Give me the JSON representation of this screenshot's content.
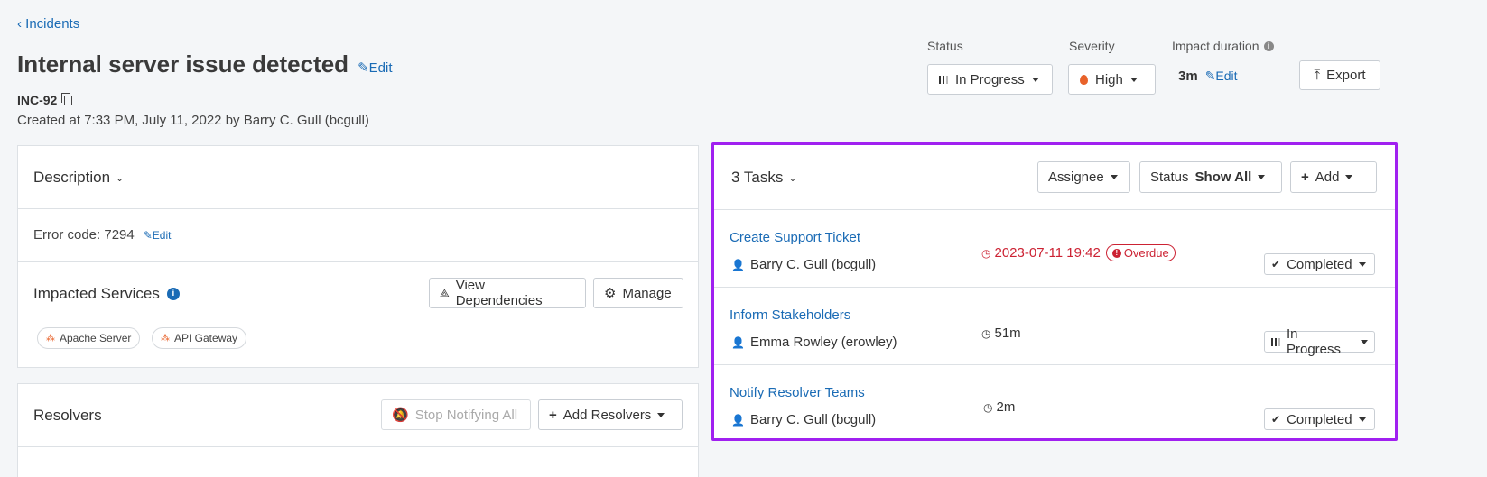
{
  "breadcrumb": {
    "back_label": "Incidents"
  },
  "incident": {
    "title": "Internal server issue detected",
    "edit_label": "Edit",
    "id": "INC-92",
    "created": "Created at 7:33 PM, July 11, 2022 by Barry C. Gull (bcgull)"
  },
  "header": {
    "status_label": "Status",
    "status_value": "In Progress",
    "severity_label": "Severity",
    "severity_value": "High",
    "impact_label": "Impact duration",
    "impact_value": "3m",
    "impact_edit_label": "Edit",
    "export_label": "Export"
  },
  "description": {
    "heading": "Description",
    "text": "Error code: 7294",
    "edit_label": "Edit"
  },
  "impacted_services": {
    "heading": "Impacted Services",
    "view_dependencies_label": "View Dependencies",
    "manage_label": "Manage",
    "services": [
      "Apache Server",
      "API Gateway"
    ]
  },
  "resolvers": {
    "heading": "Resolvers",
    "stop_notifying_label": "Stop Notifying All",
    "add_resolvers_label": "Add Resolvers"
  },
  "tasks": {
    "heading": "3 Tasks",
    "assignee_label": "Assignee",
    "status_filter_label": "Status",
    "status_filter_value": "Show All",
    "add_label": "Add",
    "items": [
      {
        "title": "Create Support Ticket",
        "assignee": "Barry C. Gull (bcgull)",
        "time": "2023-07-11 19:42",
        "badge": "Overdue",
        "status": "Completed"
      },
      {
        "title": "Inform Stakeholders",
        "assignee": "Emma Rowley (erowley)",
        "time": "51m",
        "status": "In Progress"
      },
      {
        "title": "Notify Resolver Teams",
        "assignee": "Barry C. Gull (bcgull)",
        "time": "2m",
        "status": "Completed"
      }
    ]
  },
  "colors": {
    "link": "#1a6bb5",
    "overdue": "#cc2233",
    "highlight": "#a020f0",
    "severity_flame": "#e8622a",
    "service_icon": "#e8622a"
  }
}
